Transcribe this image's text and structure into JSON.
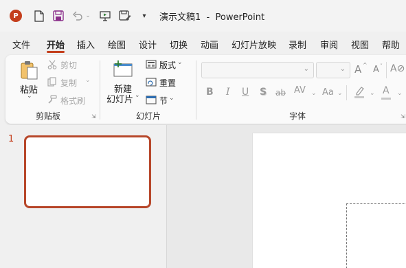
{
  "window": {
    "app_icon": "powerpoint-logo-icon",
    "app_letter": "P",
    "title": "演示文稿1  -  PowerPoint"
  },
  "quick_access": [
    "new-file-icon",
    "save-icon",
    "undo-icon",
    "undo-dropdown-icon",
    "present-icon",
    "save-as-icon",
    "customize-dropdown-icon"
  ],
  "tabs": [
    "文件",
    "开始",
    "插入",
    "绘图",
    "设计",
    "切换",
    "动画",
    "幻灯片放映",
    "录制",
    "审阅",
    "视图",
    "帮助"
  ],
  "active_tab": "开始",
  "ribbon": {
    "clipboard": {
      "paste": "粘贴",
      "cut": "剪切",
      "copy": "复制",
      "format_painter": "格式刷",
      "group_label": "剪贴板"
    },
    "slides": {
      "new_slide_line1": "新建",
      "new_slide_line2": "幻灯片",
      "layout": "版式",
      "reset": "重置",
      "section": "节",
      "group_label": "幻灯片"
    },
    "font": {
      "font_name": "",
      "font_size": "",
      "grow": "A",
      "shrink": "A",
      "bold": "B",
      "italic": "I",
      "underline": "U",
      "shadow": "S",
      "strike": "ab",
      "spacing": "AV",
      "case": "Aa",
      "font_color": "A",
      "group_label": "字体"
    }
  },
  "thumbnails": [
    {
      "number": "1"
    }
  ],
  "colors": {
    "accent": "#c43e1c",
    "thumb_border": "#b7472a"
  }
}
